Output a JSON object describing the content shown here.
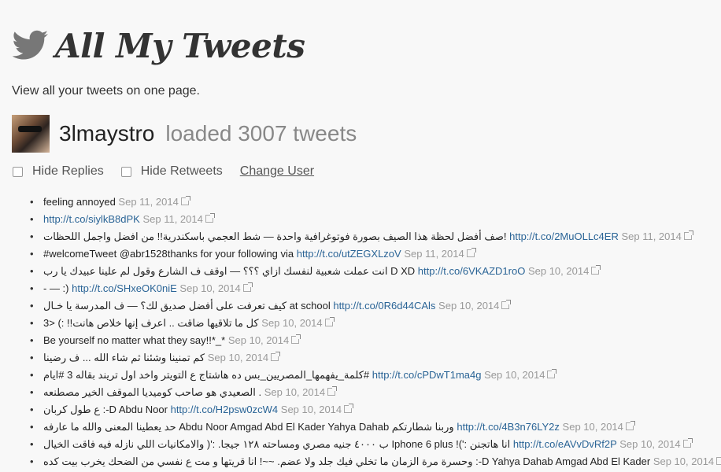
{
  "app": {
    "title": "All My Tweets",
    "tagline": "View all your tweets on one page."
  },
  "user": {
    "username": "3lmaystro",
    "loaded_text": "loaded 3007 tweets"
  },
  "controls": {
    "hide_replies": "Hide Replies",
    "hide_retweets": "Hide Retweets",
    "change_user": "Change User"
  },
  "icons": {
    "logo": "twitter-bird-icon",
    "external": "external-link-icon"
  },
  "colors": {
    "link": "#2a6496",
    "date": "#999999"
  },
  "tweets": [
    {
      "pre": "feeling annoyed ",
      "link": "",
      "post": "",
      "date": "Sep 11, 2014"
    },
    {
      "pre": "",
      "link": "http://t.co/siylkB8dPK",
      "post": " ",
      "date": "Sep 11, 2014"
    },
    {
      "pre": "صف أفضل لحظة هذا الصيف بصورة فوتوغرافية واحدة — شط العجمي باسكندرية!! من افضل واجمل اللحظات! ",
      "link": "http://t.co/2MuOLLc4ER",
      "post": " ",
      "date": "Sep 11, 2014"
    },
    {
      "pre": "#welcomeTweet @abr1528thanks for your following via ",
      "link": "http://t.co/utZEGXLzoV",
      "post": " ",
      "date": "Sep 11, 2014"
    },
    {
      "pre": "انت عملت شعبية لنفسك ازاي ؟؟؟ — اوقف ف الشارع وقول لم علينا عبيدك يا رب D XD ",
      "link": "http://t.co/6VKAZD1roO",
      "post": " ",
      "date": "Sep 10, 2014"
    },
    {
      "pre": "- — :) ",
      "link": "http://t.co/SHxeOK0niE",
      "post": " ",
      "date": "Sep 10, 2014"
    },
    {
      "pre": "كيف تعرفت على أفضل صديق لك؟ — ف المدرسة يا خـال at school ",
      "link": "http://t.co/0R6d44CAls",
      "post": " ",
      "date": "Sep 10, 2014"
    },
    {
      "pre": "كل ما تلاقيها ضاقت .. اعرف إنها خلاص هانت!! :) <3 ",
      "link": "",
      "post": "",
      "date": "Sep 10, 2014"
    },
    {
      "pre": "Be yourself no matter what they say!!*_* ",
      "link": "",
      "post": "",
      "date": "Sep 10, 2014"
    },
    {
      "pre": "كم تمنينا وشئنا ثم شاء الله ... ف رضينا ",
      "link": "",
      "post": "",
      "date": "Sep 10, 2014"
    },
    {
      "pre": "كلمة_يفهمها_المصريين_بس ده هاشتاج ع التويتر واخد اول تريند بقاله 3 #ايام# ",
      "link": "http://t.co/cPDwT1ma4g",
      "post": " ",
      "date": "Sep 10, 2014"
    },
    {
      "pre": "الصعيدي هو صاحب كوميديا الموقف الخير مصطنعه . ",
      "link": "",
      "post": "",
      "date": "Sep 10, 2014"
    },
    {
      "pre": "ع طول كربان :-D Abdu Noor ",
      "link": "http://t.co/H2psw0zcW4",
      "post": " ",
      "date": "Sep 10, 2014"
    },
    {
      "pre": "حد يعطينا المعنى والله ما عارفه Abdu Noor Amgad Abd El Kader Yahya Dahab وربنا شطارتكم ",
      "link": "http://t.co/4B3n76LY2z",
      "post": " ",
      "date": "Sep 10, 2014"
    },
    {
      "pre": "ب ٤٠٠٠ جنيه مصري ومساحته ١٢٨ جيجا. :'( والامكانيات اللي نازله فيه فاقت الخيال Iphone 6 plus !(': انا هاتجنن ",
      "link": "http://t.co/eAVvDvRf2P",
      "post": " ",
      "date": "Sep 10, 2014"
    },
    {
      "pre": "وحسرة مرة الزمان ما تخلي فيك جلد ولا عضم. ~~! انا قريتها و مت ع نفسي من الضحك يخرب بيت كده :-D Yahya Dahab Amgad Abd El Kader ",
      "link": "",
      "post": "",
      "date": "Sep 10, 2014"
    }
  ]
}
